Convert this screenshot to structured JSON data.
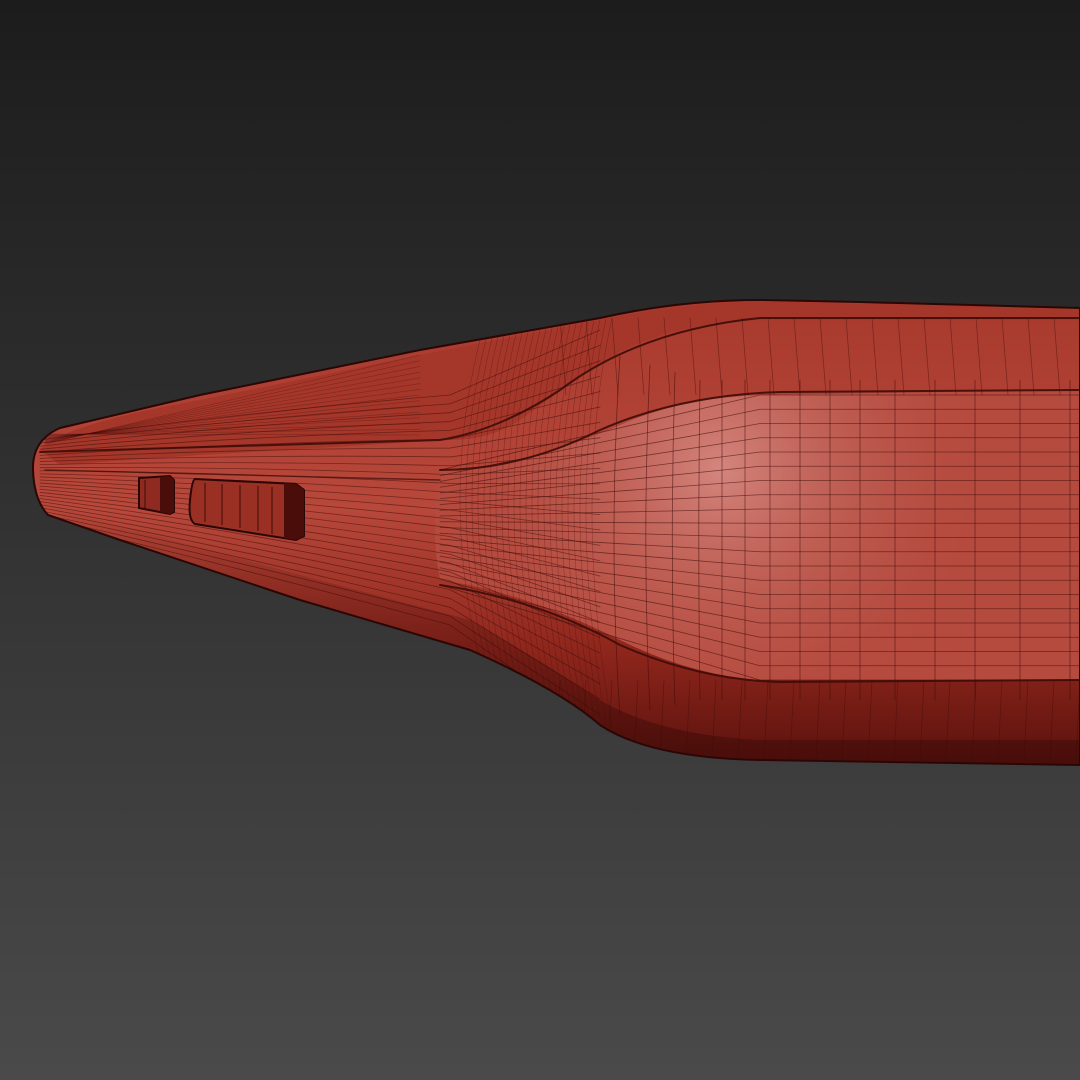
{
  "scene": {
    "description_visible_text": [],
    "background": {
      "top_color": "#1c1c1c",
      "bottom_color": "#4a4a4a"
    },
    "model": {
      "base_color": "#b03a2e",
      "highlight_color": "#cf7a72",
      "shadow_color": "#5e1410",
      "wire_color": "#3d0c08",
      "buttons": 2
    }
  }
}
